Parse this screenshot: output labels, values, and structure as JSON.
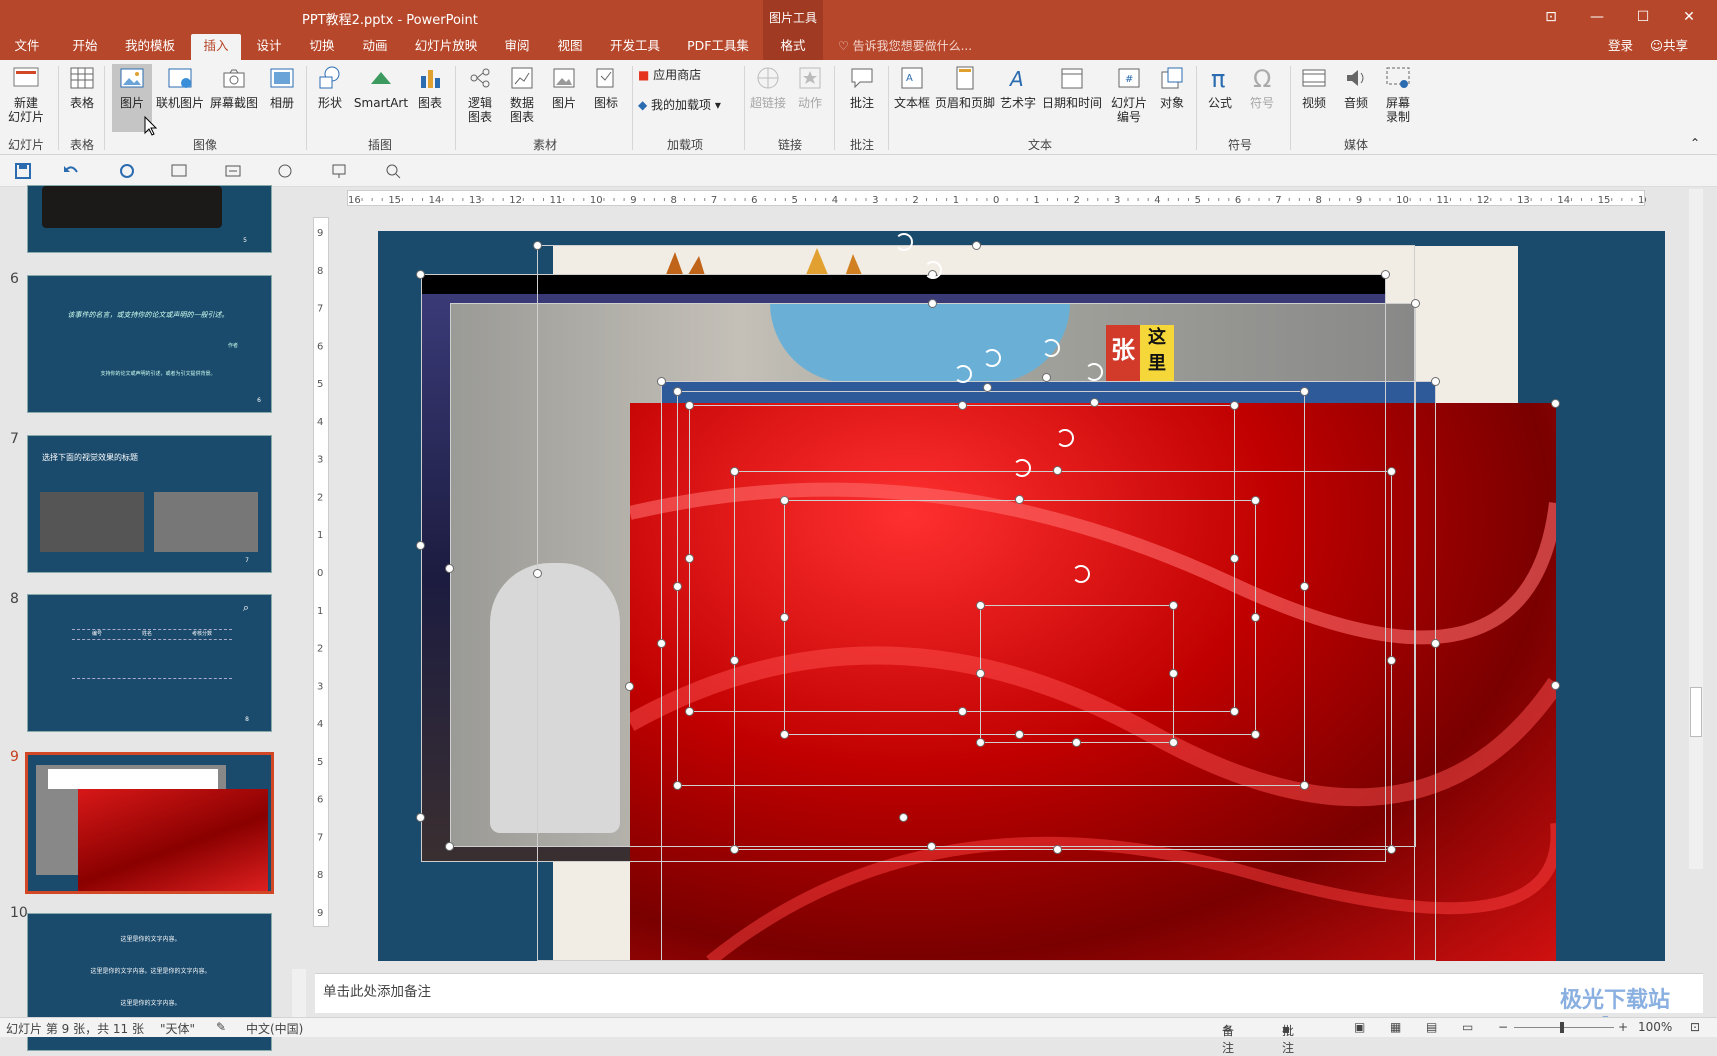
{
  "window": {
    "title": "PPT教程2.pptx - PowerPoint",
    "context_group": "图片工具",
    "controls": [
      "⊡",
      "—",
      "☐",
      "✕"
    ]
  },
  "tabs": [
    {
      "label": "文件"
    },
    {
      "label": "开始"
    },
    {
      "label": "我的模板"
    },
    {
      "label": "插入",
      "active": true
    },
    {
      "label": "设计"
    },
    {
      "label": "切换"
    },
    {
      "label": "动画"
    },
    {
      "label": "幻灯片放映"
    },
    {
      "label": "审阅"
    },
    {
      "label": "视图"
    },
    {
      "label": "开发工具"
    },
    {
      "label": "PDF工具集"
    },
    {
      "label": "格式"
    }
  ],
  "tellme": "告诉我您想要做什么...",
  "signin": "登录",
  "share": "共享",
  "ribbon": {
    "buttons": {
      "new_slide": "新建\n幻灯片",
      "table": "表格",
      "picture": "图片",
      "online_picture": "联机图片",
      "screenshot": "屏幕截图",
      "album": "相册",
      "shapes": "形状",
      "smartart": "SmartArt",
      "chart": "图表",
      "logic_chart": "逻辑\n图表",
      "data_chart": "数据\n图表",
      "picture2": "图片",
      "icon": "图标",
      "app_store": "应用商店",
      "my_addins": "我的加载项",
      "hyperlink": "超链接",
      "action": "动作",
      "comment": "批注",
      "textbox": "文本框",
      "header_footer": "页眉和页脚",
      "wordart": "艺术字",
      "datetime": "日期和时间",
      "slide_number": "幻灯片\n编号",
      "object": "对象",
      "equation": "公式",
      "symbol": "符号",
      "video": "视频",
      "audio": "音频",
      "screen_record": "屏幕\n录制"
    },
    "groups": {
      "slides": "幻灯片",
      "tables": "表格",
      "images": "图像",
      "illustrations": "插图",
      "materials": "素材",
      "addins": "加载项",
      "links": "链接",
      "comments": "批注",
      "text": "文本",
      "symbols": "符号",
      "media": "媒体"
    }
  },
  "slides": [
    {
      "num": "6",
      "lines": [
        "该事件的名言，或支持你的论文或声明的一般引述。",
        "作者",
        "支持你的论文或声明的引述，或者为引文提供背景。"
      ]
    },
    {
      "num": "7",
      "lines": [
        "选择下面的视觉效果的标题"
      ]
    },
    {
      "num": "8",
      "lines": [
        "编号",
        "姓名",
        "考核分数"
      ]
    },
    {
      "num": "9",
      "lines": []
    },
    {
      "num": "10",
      "lines": [
        "这里是你的文字内容。",
        "这里是你的文字内容。这里是你的文字内容。",
        "这里是你的文字内容。"
      ]
    }
  ],
  "slide_thumb_5_num": "5",
  "slide_badges": {
    "s6": "6",
    "s7": "7",
    "s8": "8"
  },
  "sticker": {
    "left": "张",
    "right_top": "这",
    "right_bottom": "里"
  },
  "notes_placeholder": "单击此处添加备注",
  "status": {
    "slide_info": "幻灯片 第 9 张，共 11 张",
    "theme": "\"天体\"",
    "language": "中文(中国)",
    "notes": "备注",
    "comments": "批注",
    "zoom": "100%"
  },
  "ruler": {
    "h_ticks": [
      "16",
      "15",
      "14",
      "13",
      "12",
      "11",
      "10",
      "9",
      "8",
      "7",
      "6",
      "5",
      "4",
      "3",
      "2",
      "1",
      "0",
      "1",
      "2",
      "3",
      "4",
      "5",
      "6",
      "7",
      "8",
      "9",
      "10",
      "11",
      "12",
      "13",
      "14",
      "15",
      "16"
    ],
    "v_ticks": [
      "9",
      "8",
      "7",
      "6",
      "5",
      "4",
      "3",
      "2",
      "1",
      "0",
      "1",
      "2",
      "3",
      "4",
      "5",
      "6",
      "7",
      "8",
      "9"
    ]
  },
  "watermark": {
    "text": "极光下载站",
    "sub": "www.xz7.com"
  },
  "colors": {
    "accent": "#b7472a",
    "slide_bg": "#1a4a6c",
    "selected_thumb": "#d24726"
  }
}
